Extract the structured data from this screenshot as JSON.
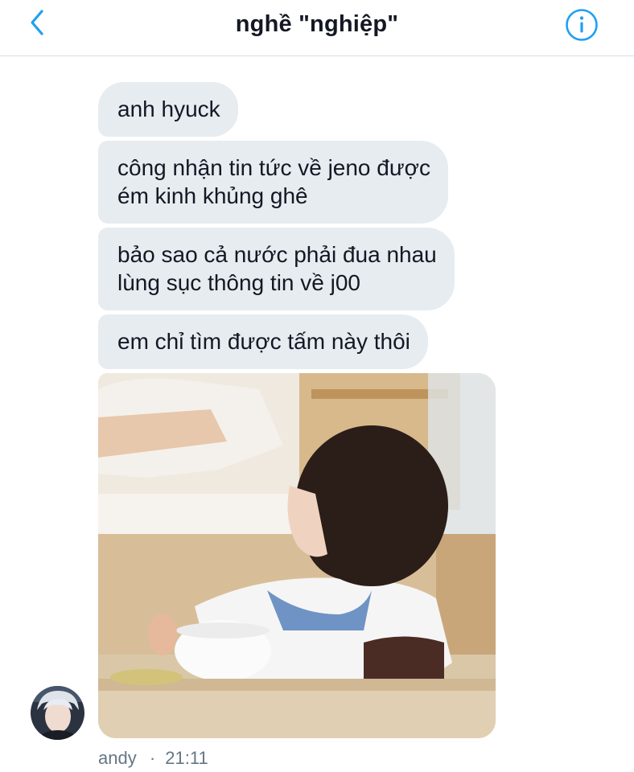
{
  "header": {
    "title": "nghề \"nghiệp\""
  },
  "messages": [
    {
      "text": "anh hyuck"
    },
    {
      "text": "công nhận tin tức về jeno được\ném kinh khủng ghê"
    },
    {
      "text": "bảo sao cả nước phải đua nhau\nlùng sục thông tin về j00"
    },
    {
      "text": "em chỉ tìm được tấm này thôi"
    }
  ],
  "meta": {
    "sender": "andy",
    "separator": "·",
    "time": "21:11"
  },
  "colors": {
    "accent": "#1da1f2",
    "bubble": "#e6ecf0",
    "meta_text": "#657786"
  },
  "icons": {
    "back": "chevron-left-icon",
    "info": "info-icon"
  }
}
